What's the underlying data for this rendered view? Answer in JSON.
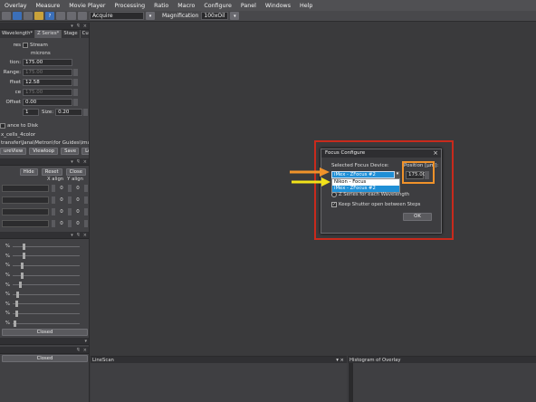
{
  "menubar": [
    "Overlay",
    "Measure",
    "Movie Player",
    "Processing",
    "Ratio",
    "Macro",
    "Configure",
    "Panel",
    "Windows",
    "Help"
  ],
  "toolbar": {
    "acquire_label": "Acquire",
    "magnification_label": "Magnification",
    "magnification_value": "100xOil"
  },
  "left_top": {
    "tabs": [
      "Wavelength*",
      "Z Series*",
      "Stage",
      "Custom"
    ],
    "rows": [
      {
        "label": "res",
        "value": "",
        "extra": "Stream"
      },
      {
        "label": "",
        "value": "",
        "extra": "microns"
      },
      {
        "label": "tion:",
        "value": "175.00"
      },
      {
        "label": "Range:",
        "value": "175.00"
      },
      {
        "label": "ffset",
        "value": "12.58"
      },
      {
        "label": "ce",
        "value": "175.00"
      },
      {
        "label": "Offset",
        "value": "0.00"
      },
      {
        "label": "",
        "value": "1",
        "size_label": "Size:",
        "size_value": "0.20"
      }
    ],
    "save_to_disk": "ance to Disk",
    "save_name": "x_cells_4color",
    "save_path": "transfer\\Jana\\Metron\\for Guides\\images a",
    "buttons": [
      "ureView",
      "Viewloop",
      "Save",
      "Load"
    ]
  },
  "left_mid": {
    "buttons": [
      "Hide",
      "Reset",
      "Close"
    ],
    "x_align": "X align",
    "y_align": "Y align",
    "rows": [
      {
        "x": "0",
        "y": "0"
      },
      {
        "x": "0",
        "y": "0"
      },
      {
        "x": "0",
        "y": "0"
      },
      {
        "x": "0",
        "y": "0"
      }
    ]
  },
  "left_bottom": {
    "sliders": [
      {
        "label": "%",
        "level": 0.15
      },
      {
        "label": "%",
        "level": 0.15
      },
      {
        "label": "%",
        "level": 0.12
      },
      {
        "label": "%",
        "level": 0.12
      },
      {
        "label": "%",
        "level": 0.1
      },
      {
        "label": "%",
        "level": 0.06
      },
      {
        "label": "%",
        "level": 0.04
      },
      {
        "label": "%",
        "level": 0.04
      },
      {
        "label": "%",
        "level": 0.02
      }
    ],
    "closed_1": "Closed",
    "closed_2": "Closed"
  },
  "bottom_panels": {
    "linescan": "LineScan",
    "histogram": "Histogram of Overlay"
  },
  "dialog": {
    "title": "Focus Configure",
    "device_label": "Selected Focus Device:",
    "device_value": "iMex - ZFocus #2",
    "position_label": "Position [µm]:",
    "position_value": "175.00",
    "dropdown_options": [
      "Nikon - Focus",
      "iMex - ZFocus #2"
    ],
    "option_zseries": "Z Series for each Wavelength",
    "option_shutter": "Keep Shutter open between Steps",
    "ok": "OK"
  },
  "colors": {
    "highlight_red": "#c82a1c",
    "highlight_orange": "#f0922a",
    "arrow_yellow": "#f2e21a",
    "selection_blue": "#1f8fd6"
  }
}
